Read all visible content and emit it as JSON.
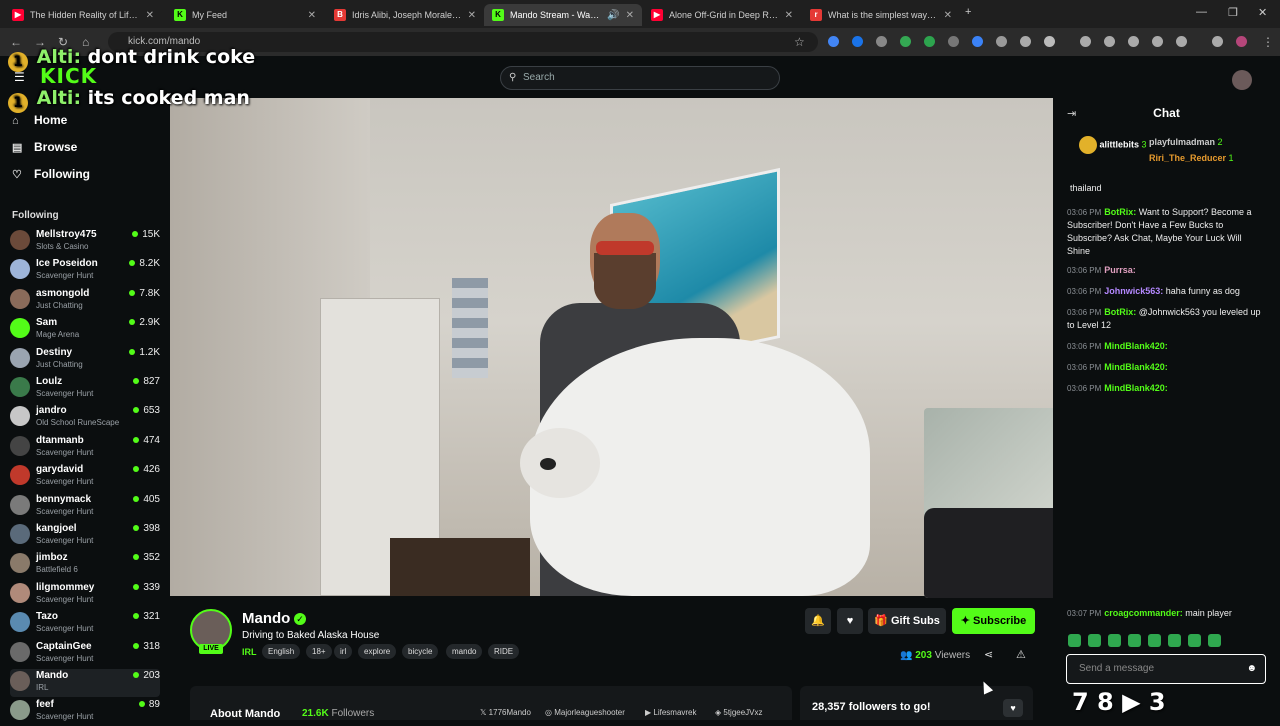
{
  "browser": {
    "tabs": [
      {
        "label": "The Hidden Reality of Life in Pu",
        "favicon_color": "#ff0033",
        "active": false
      },
      {
        "label": "My Feed",
        "favicon_color": "#53fc18",
        "active": false
      },
      {
        "label": "Idris Alibi, Joseph Morales Bett",
        "favicon_color": "#e53935",
        "active": false
      },
      {
        "label": "Mando Stream - Watch Live",
        "favicon_color": "#53fc18",
        "active": true
      },
      {
        "label": "Alone Off-Grid in Deep Rural C",
        "favicon_color": "#ff0033",
        "active": false
      },
      {
        "label": "What is the simplest way for a",
        "favicon_color": "#e53935",
        "active": false
      }
    ],
    "url": "kick.com/mando"
  },
  "header": {
    "logo": "KICK",
    "search_placeholder": "Search"
  },
  "overlay_chat": [
    {
      "name": "Alti:",
      "text": "dont drink coke"
    },
    {
      "name": "Alti:",
      "text": "its cooked man"
    }
  ],
  "overlay_badge": "1",
  "sidebar": {
    "nav": [
      {
        "label": "Home",
        "icon": "home-icon"
      },
      {
        "label": "Browse",
        "icon": "browse-icon"
      },
      {
        "label": "Following",
        "icon": "heart-icon"
      }
    ],
    "following_header": "Following",
    "channels": [
      {
        "name": "Mellstroy475",
        "category": "Slots & Casino",
        "viewers": "15K",
        "color": "#6b4a3a"
      },
      {
        "name": "Ice Poseidon",
        "category": "Scavenger Hunt",
        "viewers": "8.2K",
        "color": "#9db4d8"
      },
      {
        "name": "asmongold",
        "category": "Just Chatting",
        "viewers": "7.8K",
        "color": "#8a6b5a"
      },
      {
        "name": "Sam",
        "category": "Mage Arena",
        "viewers": "2.9K",
        "color": "#53fc18"
      },
      {
        "name": "Destiny",
        "category": "Just Chatting",
        "viewers": "1.2K",
        "color": "#9aa4b0"
      },
      {
        "name": "Loulz",
        "category": "Scavenger Hunt",
        "viewers": "827",
        "color": "#3a7a4a"
      },
      {
        "name": "jandro",
        "category": "Old School RuneScape",
        "viewers": "653",
        "color": "#c7c7c7"
      },
      {
        "name": "dtanmanb",
        "category": "Scavenger Hunt",
        "viewers": "474",
        "color": "#444"
      },
      {
        "name": "garydavid",
        "category": "Scavenger Hunt",
        "viewers": "426",
        "color": "#c0392b"
      },
      {
        "name": "bennymack",
        "category": "Scavenger Hunt",
        "viewers": "405",
        "color": "#7a7a7a"
      },
      {
        "name": "kangjoel",
        "category": "Scavenger Hunt",
        "viewers": "398",
        "color": "#5a6a7a"
      },
      {
        "name": "jimboz",
        "category": "Battlefield 6",
        "viewers": "352",
        "color": "#8a7a6a"
      },
      {
        "name": "lilgmommey",
        "category": "Scavenger Hunt",
        "viewers": "339",
        "color": "#b08a7a"
      },
      {
        "name": "Tazo",
        "category": "Scavenger Hunt",
        "viewers": "321",
        "color": "#5a8ab0"
      },
      {
        "name": "CaptainGee",
        "category": "Scavenger Hunt",
        "viewers": "318",
        "color": "#6a6a6a"
      },
      {
        "name": "Mando",
        "category": "IRL",
        "viewers": "203",
        "color": "#6a5e59"
      },
      {
        "name": "feef",
        "category": "Scavenger Hunt",
        "viewers": "89",
        "color": "#8a9a8a"
      }
    ]
  },
  "chat": {
    "title": "Chat",
    "gifters": [
      {
        "name": "alittlebits",
        "count": "3"
      },
      {
        "name": "playfulmadman",
        "count": "2"
      },
      {
        "name": "Riri_The_Reducer",
        "count": "1"
      }
    ],
    "messages": [
      {
        "time": "",
        "user": "",
        "text": "thailand",
        "color": "#eee"
      },
      {
        "time": "03:06 PM",
        "user": "BotRix:",
        "text": "Want to Support? Become a Subscriber! Don't Have a Few Bucks to Subscribe? Ask Chat, Maybe Your Luck Will Shine",
        "color": "#53fc18"
      },
      {
        "time": "03:06 PM",
        "user": "Purrsa:",
        "text": "",
        "color": "#e0a0c0"
      },
      {
        "time": "03:06 PM",
        "user": "Johnwick563:",
        "text": "haha funny as dog",
        "color": "#b488ff"
      },
      {
        "time": "03:06 PM",
        "user": "BotRix:",
        "text": "@Johnwick563 you leveled up to Level 12",
        "color": "#53fc18"
      },
      {
        "time": "03:06 PM",
        "user": "MindBlank420:",
        "text": "",
        "color": "#53fc18"
      },
      {
        "time": "03:06 PM",
        "user": "MindBlank420:",
        "text": "",
        "color": "#53fc18"
      },
      {
        "time": "03:06 PM",
        "user": "MindBlank420:",
        "text": "",
        "color": "#53fc18"
      },
      {
        "time": "03:07 PM",
        "user": "croagcommander:",
        "text": "main player",
        "color": "#53fc18"
      }
    ],
    "input_placeholder": "Send a message"
  },
  "stream": {
    "streamer": "Mando",
    "title": "Driving to Baked Alaska House",
    "category": "IRL",
    "live_label": "LIVE",
    "tags": [
      "English",
      "18+",
      "irl",
      "explore",
      "bicycle",
      "mando",
      "RIDE"
    ],
    "gift_subs_label": "Gift Subs",
    "subscribe_label": "Subscribe",
    "viewers_count": "203",
    "viewers_label": "Viewers"
  },
  "about": {
    "title": "About Mando",
    "followers": "21.6K",
    "followers_label": "Followers",
    "socials": [
      "1776Mando",
      "Majorleagueshooter",
      "Lifesmavrek",
      "5tjgeeJVxz"
    ]
  },
  "goal": {
    "text": "28,357 followers to go!"
  },
  "overlay_bottom": "7 8 ▶ 3"
}
